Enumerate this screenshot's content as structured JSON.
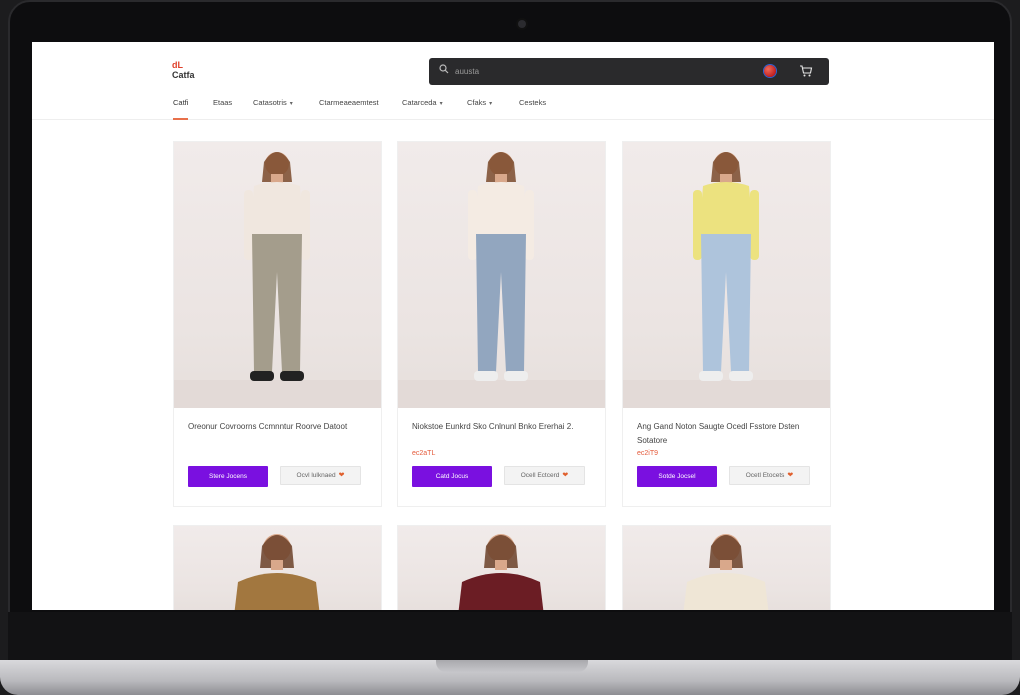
{
  "header": {
    "logo_mark": "dL",
    "logo_text": "Catfa",
    "search_placeholder": "auusta"
  },
  "nav": {
    "items": [
      {
        "label": "Catfi",
        "dropdown": false,
        "active": true
      },
      {
        "label": "Etaas",
        "dropdown": false,
        "active": false
      },
      {
        "label": "Catasotris",
        "dropdown": true,
        "active": false
      },
      {
        "label": "Ctarmeaeaemtest",
        "dropdown": false,
        "active": false
      },
      {
        "label": "Catarceda",
        "dropdown": true,
        "active": false
      },
      {
        "label": "Cfaks",
        "dropdown": true,
        "active": false
      },
      {
        "label": "Cesteks",
        "dropdown": false,
        "active": false
      }
    ]
  },
  "products": [
    {
      "title": "Oreonur Covroorns Ccmnntur Roorve Datoot",
      "price": "",
      "primary_label": "Stere Jocens",
      "secondary_label": "Ocvl lulknaed",
      "top_color": "#f0e7df",
      "bottom_color": "#a49d8c"
    },
    {
      "title": "Niokstoe Eunkrd Sko Cnlnunl Bnko Ererhai 2.",
      "price": "ec2aTL",
      "primary_label": "Catd Jocus",
      "secondary_label": "Ocell Ectcerd",
      "top_color": "#f4ebe3",
      "bottom_color": "#92a6bf"
    },
    {
      "title": "Ang Gand Noton Saugte Ocedl Fsstore Dsten Sotatore",
      "price": "ec2iT9",
      "primary_label": "Sotde Jocsel",
      "secondary_label": "Ocetl Etocets",
      "top_color": "#ece27f",
      "bottom_color": "#aec4dc"
    }
  ],
  "row2": [
    {
      "top_color": "#a2773f"
    },
    {
      "top_color": "#6b1d24"
    },
    {
      "top_color": "#efe6d6"
    }
  ]
}
